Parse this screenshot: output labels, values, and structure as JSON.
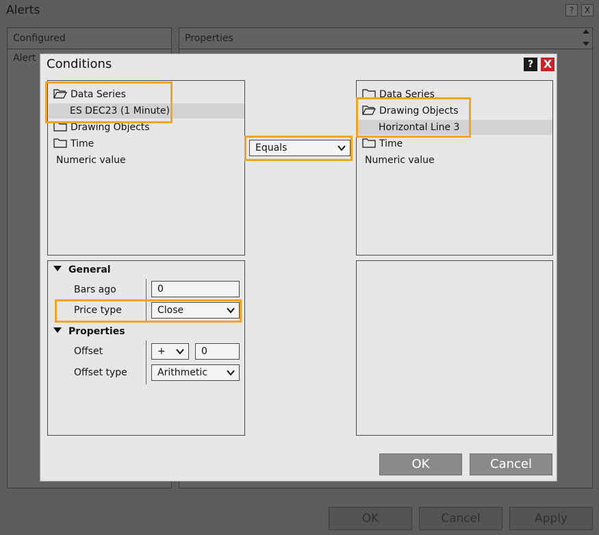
{
  "alerts_window": {
    "title": "Alerts",
    "help_label": "?",
    "close_label": "X",
    "configured_header": "Configured",
    "configured_item": "Alert",
    "properties_header": "Properties",
    "ok_label": "OK",
    "cancel_label": "Cancel",
    "apply_label": "Apply"
  },
  "conditions_dialog": {
    "title": "Conditions",
    "help_label": "?",
    "close_label": "X",
    "left_tree": {
      "items": [
        {
          "label": "Data Series",
          "icon": "folder-open-icon"
        },
        {
          "label": "ES DEC23 (1 Minute)"
        },
        {
          "label": "Drawing Objects",
          "icon": "folder-icon"
        },
        {
          "label": "Time",
          "icon": "folder-icon"
        },
        {
          "label": "Numeric value"
        }
      ]
    },
    "operator": {
      "value": "Equals"
    },
    "right_tree": {
      "items": [
        {
          "label": "Data Series",
          "icon": "folder-icon"
        },
        {
          "label": "Drawing Objects",
          "icon": "folder-open-icon"
        },
        {
          "label": "Horizontal Line 3"
        },
        {
          "label": "Time",
          "icon": "folder-icon"
        },
        {
          "label": "Numeric value"
        }
      ]
    },
    "property_grid": {
      "general_section": "General",
      "bars_ago_label": "Bars ago",
      "bars_ago_value": "0",
      "price_type_label": "Price type",
      "price_type_value": "Close",
      "properties_section": "Properties",
      "offset_label": "Offset",
      "offset_sign": "+",
      "offset_value": "0",
      "offset_type_label": "Offset type",
      "offset_type_value": "Arithmetic"
    },
    "ok_label": "OK",
    "cancel_label": "Cancel"
  },
  "colors": {
    "highlight": "#f2a51a",
    "dialog_bg": "#e6e7e8",
    "close_red": "#c8232a"
  }
}
